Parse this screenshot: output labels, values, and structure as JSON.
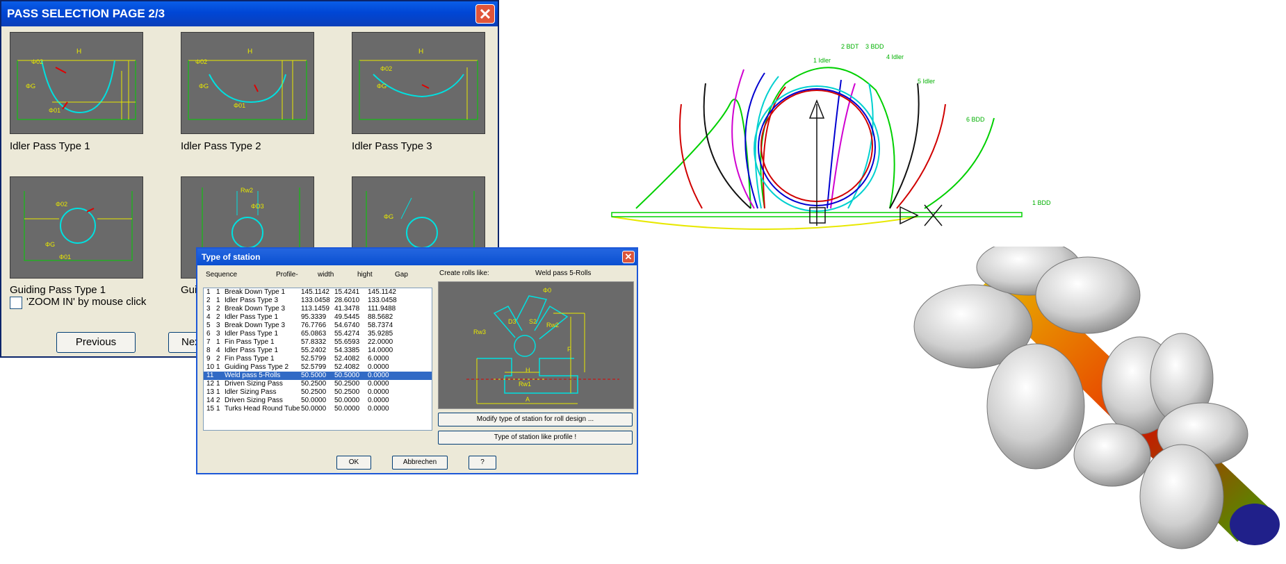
{
  "pass_window": {
    "title": "PASS SELECTION PAGE 2/3",
    "close_glyph": "✕",
    "thumbnails": [
      {
        "caption": "Idler Pass Type   1"
      },
      {
        "caption": "Idler Pass Type   2"
      },
      {
        "caption": "Idler Pass Type   3"
      },
      {
        "caption": "Guiding Pass Type 1"
      },
      {
        "caption": "Guid"
      },
      {
        "caption": ""
      }
    ],
    "zoom_label": "'ZOOM IN' by mouse click",
    "previous_label": "Previous",
    "next_label": "Nex"
  },
  "station_dialog": {
    "title": "Type of station",
    "close_glyph": "✕",
    "headers": {
      "sequence": "Sequence",
      "profile": "Profile-",
      "width": "width",
      "hight": "hight",
      "gap": "Gap"
    },
    "create_label": "Create rolls like:",
    "create_value": "Weld pass 5-Rolls",
    "rows": [
      {
        "seq": "1",
        "sub": "1",
        "name": "Break Down Type   1",
        "width": "145.1142",
        "hight": "15.4241",
        "gap": "145.1142"
      },
      {
        "seq": "2",
        "sub": "1",
        "name": "Idler Pass Type   3",
        "width": "133.0458",
        "hight": "28.6010",
        "gap": "133.0458"
      },
      {
        "seq": "3",
        "sub": "2",
        "name": "Break Down Type   3",
        "width": "113.1459",
        "hight": "41.3478",
        "gap": "111.9488"
      },
      {
        "seq": "4",
        "sub": "2",
        "name": "Idler Pass Type   1",
        "width": "95.3339",
        "hight": "49.5445",
        "gap": "88.5682"
      },
      {
        "seq": "5",
        "sub": "3",
        "name": "Break Down Type   3",
        "width": "76.7766",
        "hight": "54.6740",
        "gap": "58.7374"
      },
      {
        "seq": "6",
        "sub": "3",
        "name": "Idler Pass Type   1",
        "width": "65.0863",
        "hight": "55.4274",
        "gap": "35.9285"
      },
      {
        "seq": "7",
        "sub": "1",
        "name": "Fin Pass   Type   1",
        "width": "57.8332",
        "hight": "55.6593",
        "gap": "22.0000"
      },
      {
        "seq": "8",
        "sub": "4",
        "name": "Idler Pass Type   1",
        "width": "55.2402",
        "hight": "54.3385",
        "gap": "14.0000"
      },
      {
        "seq": "9",
        "sub": "2",
        "name": "Fin Pass   Type   1",
        "width": "52.5799",
        "hight": "52.4082",
        "gap": "6.0000"
      },
      {
        "seq": "10",
        "sub": "1",
        "name": "Guiding Pass Type 2",
        "width": "52.5799",
        "hight": "52.4082",
        "gap": "0.0000"
      },
      {
        "seq": "11",
        "sub": "",
        "name": "Weld pass 5-Rolls",
        "width": "50.5000",
        "hight": "50.5000",
        "gap": "0.0000",
        "selected": true
      },
      {
        "seq": "12",
        "sub": "1",
        "name": "Driven Sizing Pass",
        "width": "50.2500",
        "hight": "50.2500",
        "gap": "0.0000"
      },
      {
        "seq": "13",
        "sub": "1",
        "name": "Idler  Sizing Pass",
        "width": "50.2500",
        "hight": "50.2500",
        "gap": "0.0000"
      },
      {
        "seq": "14",
        "sub": "2",
        "name": "Driven Sizing Pass",
        "width": "50.0000",
        "hight": "50.0000",
        "gap": "0.0000"
      },
      {
        "seq": "15",
        "sub": "1",
        "name": "Turks Head Round Tube",
        "width": "50.0000",
        "hight": "50.0000",
        "gap": "0.0000"
      }
    ],
    "modify_label": "Modify type of station for roll design ...",
    "like_profile_label": "Type of station like profile !",
    "ok_label": "OK",
    "cancel_label": "Abbrechen",
    "help_label": "?"
  },
  "flower_diagram": {
    "labels": [
      "1 Idler",
      "2 BDT",
      "3 BDD",
      "4 Idler",
      "5 Idler",
      "6 BDD",
      "1 BDD"
    ]
  },
  "colors": {
    "cad_background": "#6a6a6a",
    "cad_yellow": "#e8e800",
    "cad_cyan": "#00e0e0",
    "cad_green": "#00d000",
    "cad_red": "#e00000",
    "selection": "#316ac5",
    "title_blue": "#0046d5"
  }
}
